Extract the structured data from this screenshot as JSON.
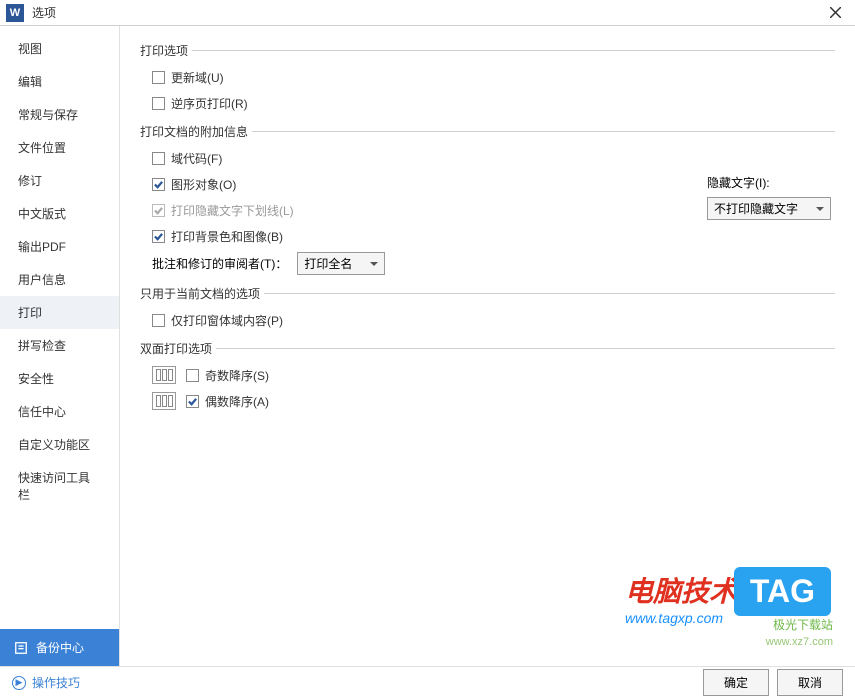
{
  "titlebar": {
    "title": "选项"
  },
  "sidebar": {
    "items": [
      {
        "label": "视图"
      },
      {
        "label": "编辑"
      },
      {
        "label": "常规与保存"
      },
      {
        "label": "文件位置"
      },
      {
        "label": "修订"
      },
      {
        "label": "中文版式"
      },
      {
        "label": "输出PDF"
      },
      {
        "label": "用户信息"
      },
      {
        "label": "打印"
      },
      {
        "label": "拼写检查"
      },
      {
        "label": "安全性"
      },
      {
        "label": "信任中心"
      },
      {
        "label": "自定义功能区"
      },
      {
        "label": "快速访问工具栏"
      }
    ],
    "backup": "备份中心"
  },
  "groups": {
    "print_options": {
      "title": "打印选项",
      "update_fields": "更新域(U)",
      "reverse_print": "逆序页打印(R)"
    },
    "additional_info": {
      "title": "打印文档的附加信息",
      "field_codes": "域代码(F)",
      "graphics": "图形对象(O)",
      "hidden_underline": "打印隐藏文字下划线(L)",
      "background": "打印背景色和图像(B)",
      "reviewer_label": "批注和修订的审阅者(T)：",
      "reviewer_value": "打印全名",
      "hidden_text_label": "隐藏文字(I):",
      "hidden_text_value": "不打印隐藏文字"
    },
    "current_doc": {
      "title": "只用于当前文档的选项",
      "form_only": "仅打印窗体域内容(P)"
    },
    "duplex": {
      "title": "双面打印选项",
      "odd_desc": "奇数降序(S)",
      "even_desc": "偶数降序(A)"
    }
  },
  "footer": {
    "help": "操作技巧",
    "ok": "确定",
    "cancel": "取消"
  },
  "watermark": {
    "line1": "电脑技术网",
    "line2": "www.tagxp.com",
    "tag": "TAG",
    "jg1": "极光下载站",
    "jg2": "www.xz7.com"
  }
}
